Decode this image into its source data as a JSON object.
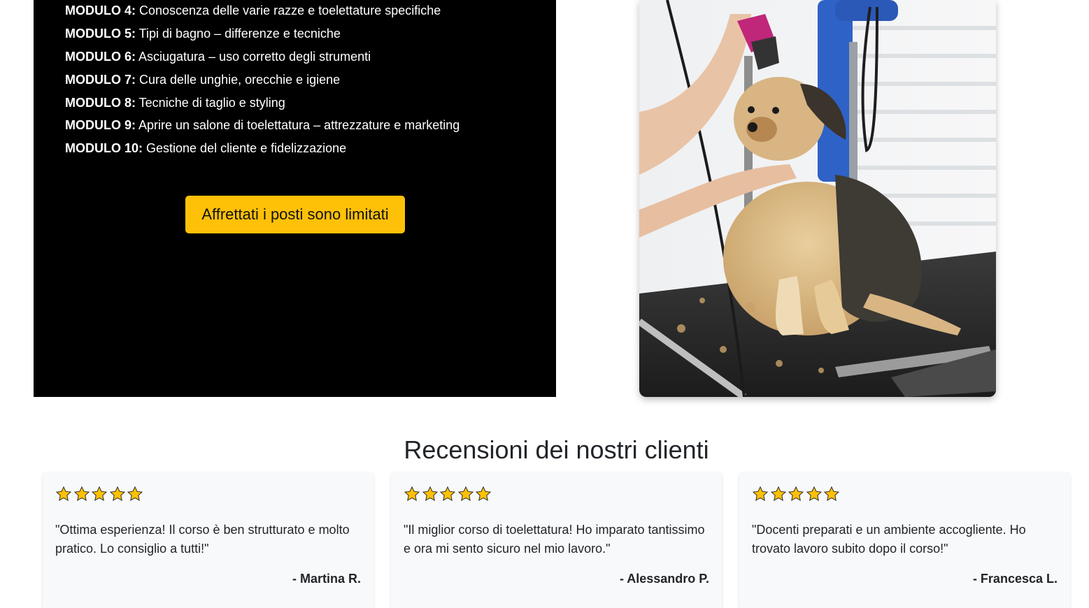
{
  "modules": [
    {
      "label": "MODULO 4:",
      "text": " Conoscenza delle varie razze e toelettature specifiche"
    },
    {
      "label": "MODULO 5:",
      "text": " Tipi di bagno – differenze e tecniche"
    },
    {
      "label": "MODULO 6:",
      "text": " Asciugatura – uso corretto degli strumenti"
    },
    {
      "label": "MODULO 7:",
      "text": " Cura delle unghie, orecchie e igiene"
    },
    {
      "label": "MODULO 8:",
      "text": " Tecniche di taglio e styling"
    },
    {
      "label": "MODULO 9:",
      "text": " Aprire un salone di toelettatura – attrezzature e marketing"
    },
    {
      "label": "MODULO 10:",
      "text": " Gestione del cliente e fidelizzazione"
    }
  ],
  "cta": {
    "label": "Affrettati i posti sono limitati",
    "color": "#ffc107"
  },
  "photo": {
    "subject": "dog-grooming-photo"
  },
  "reviews": {
    "title": "Recensioni dei nostri clienti",
    "items": [
      {
        "stars": 5,
        "text": "\"Ottima esperienza! Il corso è ben strutturato e molto pratico. Lo consiglio a tutti!\"",
        "author": "- Martina R."
      },
      {
        "stars": 5,
        "text": "\"Il miglior corso di toelettatura! Ho imparato tantissimo e ora mi sento sicuro nel mio lavoro.\"",
        "author": "- Alessandro P."
      },
      {
        "stars": 5,
        "text": "\"Docenti preparati e un ambiente accogliente. Ho trovato lavoro subito dopo il corso!\"",
        "author": "- Francesca L."
      }
    ]
  },
  "colors": {
    "panel_bg": "#000000",
    "star": "#ffc107",
    "card_bg": "#f8f9fa"
  }
}
